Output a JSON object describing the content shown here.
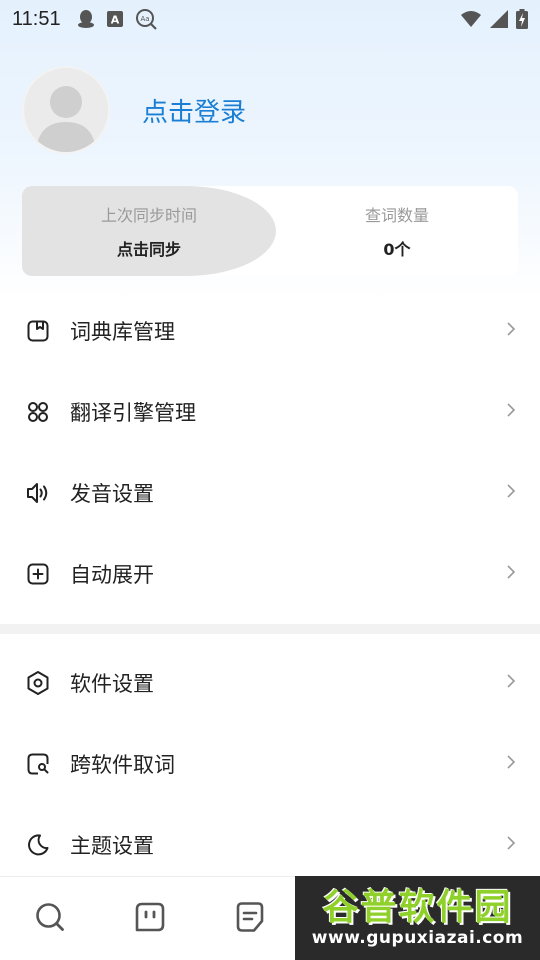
{
  "status_bar": {
    "time": "11:51",
    "left_icons": [
      "qq-icon",
      "a-box-icon",
      "translate-search-icon"
    ],
    "right_icons": [
      "wifi-icon",
      "signal-icon",
      "battery-charging-icon"
    ]
  },
  "profile": {
    "login_text": "点击登录"
  },
  "sync": {
    "last_sync_label": "上次同步时间",
    "last_sync_value": "点击同步",
    "word_count_label": "查词数量",
    "word_count_value": "0个"
  },
  "menu_group_1": [
    {
      "label": "词典库管理",
      "icon": "dictionary-icon"
    },
    {
      "label": "翻译引擎管理",
      "icon": "grid-apps-icon"
    },
    {
      "label": "发音设置",
      "icon": "speaker-icon"
    },
    {
      "label": "自动展开",
      "icon": "plus-square-icon"
    }
  ],
  "menu_group_2": [
    {
      "label": "软件设置",
      "icon": "hexagon-settings-icon"
    },
    {
      "label": "跨软件取词",
      "icon": "search-square-icon"
    },
    {
      "label": "主题设置",
      "icon": "moon-icon"
    }
  ],
  "bottom_nav": [
    {
      "icon": "search-icon"
    },
    {
      "icon": "chat-face-icon"
    },
    {
      "icon": "notes-icon"
    }
  ],
  "watermark": {
    "title": "谷普软件园",
    "url": "www.gupuxiazai.com"
  },
  "colors": {
    "accent": "#1a7fd4",
    "header_gradient_top": "#e4f1fd",
    "sync_left_bg": "#e3e3e3",
    "watermark_green": "#8fd12a"
  }
}
